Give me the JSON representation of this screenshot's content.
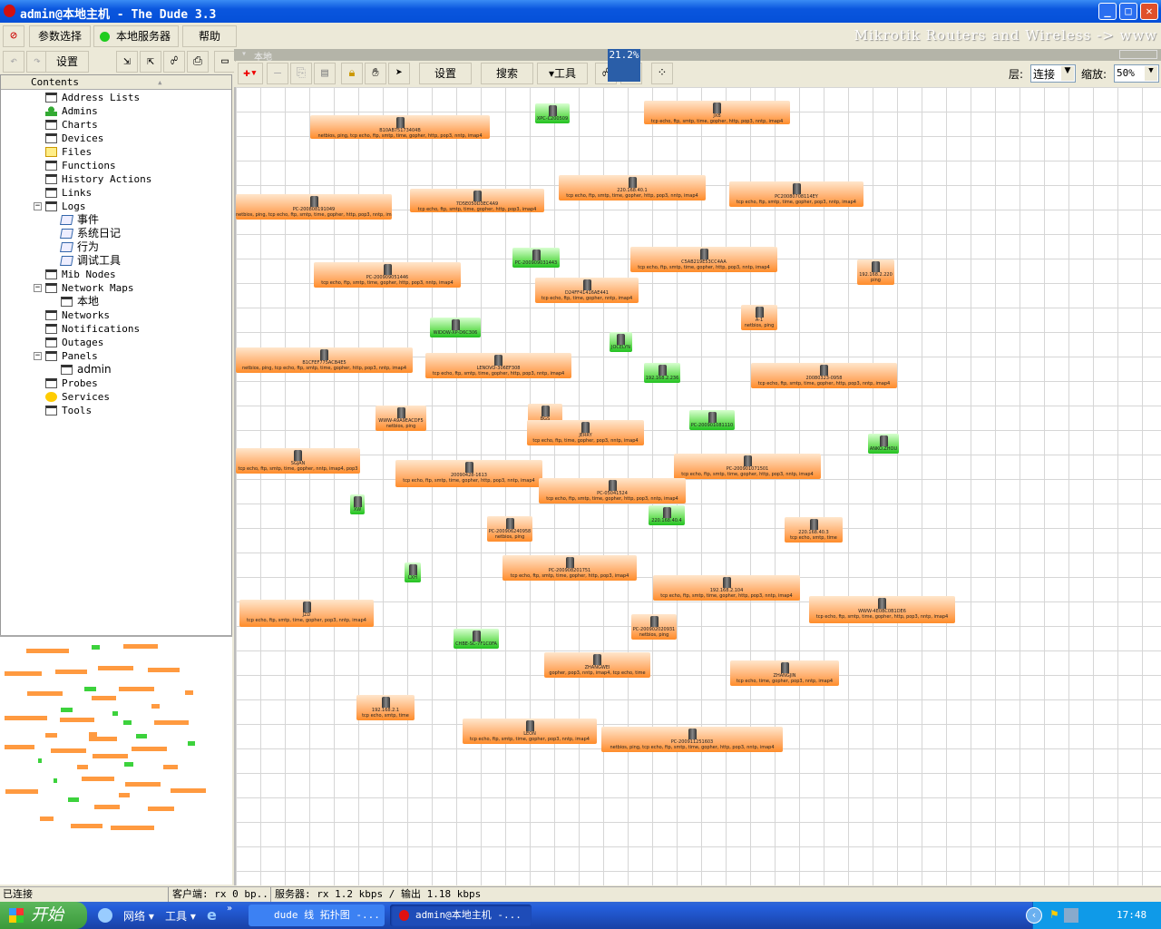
{
  "window": {
    "title": "admin@本地主机 - The Dude 3.3",
    "min": "_",
    "max": "□",
    "close": "✕"
  },
  "menu": {
    "prefs": "参数选择",
    "server": "本地服务器",
    "help": "帮助",
    "server_status_color": "#1ecc1e"
  },
  "brand": "Mikrotik Routers and Wireless -> www",
  "left_toolbar": {
    "settings": "设置"
  },
  "tree": {
    "header": "Contents",
    "items": [
      {
        "label": "Address Lists",
        "level": 0,
        "icon": "list-icon"
      },
      {
        "label": "Admins",
        "level": 0,
        "icon": "admin-icon"
      },
      {
        "label": "Charts",
        "level": 0,
        "icon": "list-icon"
      },
      {
        "label": "Devices",
        "level": 0,
        "icon": "list-icon"
      },
      {
        "label": "Files",
        "level": 0,
        "icon": "files-icon"
      },
      {
        "label": "Functions",
        "level": 0,
        "icon": "list-icon"
      },
      {
        "label": "History Actions",
        "level": 0,
        "icon": "list-icon"
      },
      {
        "label": "Links",
        "level": 0,
        "icon": "list-icon"
      },
      {
        "label": "Logs",
        "level": 0,
        "icon": "list-icon",
        "expanded": true
      },
      {
        "label": "事件",
        "level": 1,
        "icon": "log-icon"
      },
      {
        "label": "系统日记",
        "level": 1,
        "icon": "log-icon"
      },
      {
        "label": "行为",
        "level": 1,
        "icon": "log-icon"
      },
      {
        "label": "调试工具",
        "level": 1,
        "icon": "log-icon"
      },
      {
        "label": "Mib Nodes",
        "level": 0,
        "icon": "list-icon"
      },
      {
        "label": "Network Maps",
        "level": 0,
        "icon": "list-icon",
        "expanded": true
      },
      {
        "label": "本地",
        "level": 1,
        "icon": "map-icon"
      },
      {
        "label": "Networks",
        "level": 0,
        "icon": "list-icon"
      },
      {
        "label": "Notifications",
        "level": 0,
        "icon": "list-icon"
      },
      {
        "label": "Outages",
        "level": 0,
        "icon": "list-icon"
      },
      {
        "label": "Panels",
        "level": 0,
        "icon": "list-icon",
        "expanded": true
      },
      {
        "label": "admin",
        "level": 1,
        "icon": "panel-icon"
      },
      {
        "label": "Probes",
        "level": 0,
        "icon": "list-icon"
      },
      {
        "label": "Services",
        "level": 0,
        "icon": "services-icon"
      },
      {
        "label": "Tools",
        "level": 0,
        "icon": "list-icon"
      }
    ]
  },
  "map": {
    "tab_title": "本地",
    "settings": "设置",
    "search": "搜索",
    "tools": "▾工具",
    "cpu_usage": "21.2%",
    "layer_label": "层:",
    "layer_value": "连接",
    "zoom_label": "缩放:",
    "zoom_value": "50%"
  },
  "nodes": [
    {
      "name": "B10AB75173404B",
      "services": "netbios, ping, tcp echo, ftp, smtp, time, gopher, http, pop3, nntp, imap4",
      "status": "down"
    },
    {
      "name": "XPC-C200509",
      "services": "",
      "status": "up"
    },
    {
      "name": "JXB",
      "services": "tcp echo, ftp, smtp, time, gopher, http, pop3, nntp, imap4",
      "status": "down"
    },
    {
      "name": "PC-200808191049",
      "services": "netbios, ping, tcp echo, ftp, smtp, time, gopher, http, pop3, nntp, imap4",
      "status": "down"
    },
    {
      "name": "7D5E050D3EC4A9",
      "services": "tcp echo, ftp, smtp, time, gopher, http, pop3, imap4",
      "status": "down"
    },
    {
      "name": "220.168.40.1",
      "services": "tcp echo, ftp, smtp, time, gopher, http, pop3, nntp, imap4",
      "status": "down"
    },
    {
      "name": "PC20080708114EY",
      "services": "tcp echo, ftp, smtp, time, gopher, pop3, nntp, imap4",
      "status": "down"
    },
    {
      "name": "PC-200909051446",
      "services": "tcp echo, ftp, smtp, time, gopher, http, pop3, nntp, imap4",
      "status": "down"
    },
    {
      "name": "PC-200909031443",
      "services": "",
      "status": "up"
    },
    {
      "name": "C5AB219E53CC4AA",
      "services": "tcp echo, ftp, smtp, time, gopher, http, pop3, nntp, imap4",
      "status": "down"
    },
    {
      "name": "192.168.2.220",
      "services": "ping",
      "status": "down"
    },
    {
      "name": "D24FF41416AE441",
      "services": "tcp echo, ftp, time, gopher, nntp, imap4",
      "status": "down"
    },
    {
      "name": "WIDOW-XP-D6C306",
      "services": "",
      "status": "up"
    },
    {
      "name": "JOCELYN",
      "services": "",
      "status": "up"
    },
    {
      "name": "A-1",
      "services": "netbios, ping",
      "status": "down"
    },
    {
      "name": "B1CFEF775ACB4E5",
      "services": "netbios, ping, tcp echo, ftp, smtp, time, gopher, http, pop3, nntp, imap4",
      "status": "down"
    },
    {
      "name": "LENOVO-306EF308",
      "services": "tcp echo, ftp, smtp, time, gopher, http, pop3, nntp, imap4",
      "status": "down"
    },
    {
      "name": "192.168.2.236",
      "services": "",
      "status": "up"
    },
    {
      "name": "20080323-0958",
      "services": "tcp echo, ftp, smtp, time, gopher, http, pop3, nntp, imap4",
      "status": "down"
    },
    {
      "name": "WWW-A9A9EACDF5",
      "services": "netbios, ping",
      "status": "down"
    },
    {
      "name": "BGS",
      "services": "ping, netbios",
      "status": "down"
    },
    {
      "name": "JERRY",
      "services": "tcp echo, ftp, time, gopher, pop3, nntp, imap4",
      "status": "down"
    },
    {
      "name": "PC-200901081110",
      "services": "",
      "status": "up"
    },
    {
      "name": "ANKO.ZHOU",
      "services": "",
      "status": "up"
    },
    {
      "name": "SGJAN",
      "services": "tcp echo, ftp, smtp, time, gopher, nntp, imap4, pop3",
      "status": "down"
    },
    {
      "name": "20090428-1613",
      "services": "tcp echo, ftp, smtp, time, gopher, http, pop3, nntp, imap4",
      "status": "down"
    },
    {
      "name": "PC-200901071501",
      "services": "tcp echo, ftp, smtp, time, gopher, http, pop3, nntp, imap4",
      "status": "down"
    },
    {
      "name": "PC-05041524",
      "services": "tcp echo, ftp, smtp, time, gopher, http, pop3, nntp, imap4",
      "status": "down"
    },
    {
      "name": "XW",
      "services": "",
      "status": "up"
    },
    {
      "name": "220.168.40.4",
      "services": "",
      "status": "up"
    },
    {
      "name": "PC-200906240958",
      "services": "netbios, ping",
      "status": "down"
    },
    {
      "name": "220.168.40.3",
      "services": "tcp echo, smtp, time",
      "status": "down"
    },
    {
      "name": "PC-200908201751",
      "services": "tcp echo, ftp, smtp, time, gopher, http, pop3, imap4",
      "status": "down"
    },
    {
      "name": "LXH",
      "services": "",
      "status": "up"
    },
    {
      "name": "192.168.2.104",
      "services": "tcp echo, ftp, smtp, time, gopher, http, pop3, nntp, imap4",
      "status": "down"
    },
    {
      "name": "JZD",
      "services": "tcp echo, ftp, smtp, time, gopher, pop3, nntp, imap4",
      "status": "down"
    },
    {
      "name": "WWW-4E0BC0B1DE6",
      "services": "tcp echo, ftp, smtp, time, gopher, http, pop3, nntp, imap4",
      "status": "down"
    },
    {
      "name": "PC-200902020931",
      "services": "netbios, ping",
      "status": "down"
    },
    {
      "name": "CHBE-SC-7F1C0FA",
      "services": "",
      "status": "up"
    },
    {
      "name": "ZHANGWEI",
      "services": "gopher, pop3, nntp, imap4, tcp echo, time",
      "status": "down"
    },
    {
      "name": "ZHANGJIN",
      "services": "tcp echo, time, gopher, pop3, nntp, imap4",
      "status": "down"
    },
    {
      "name": "192.168.2.1",
      "services": "tcp echo, smtp, time",
      "status": "down"
    },
    {
      "name": "LEON",
      "services": "tcp echo, ftp, smtp, time, gopher, pop3, nntp, imap4",
      "status": "down"
    },
    {
      "name": "PC-200911251603",
      "services": "netbios, ping, tcp echo, ftp, smtp, time, gopher, http, pop3, nntp, imap4",
      "status": "down"
    }
  ],
  "status": {
    "connection": "已连接",
    "client": "客户端: rx 0 bp...",
    "server": "服务器: rx 1.2 kbps / 输出 1.18 kbps"
  },
  "taskbar": {
    "start": "开始",
    "network": "网络 ▾",
    "tools": "工具 ▾",
    "more": "»",
    "task1": "dude 线 拓扑图 -...",
    "task2": "admin@本地主机 -...",
    "clock": "17:48"
  },
  "colors": {
    "down": "#ff9a40",
    "up": "#3cd23c",
    "titlebar": "#0a56de"
  }
}
